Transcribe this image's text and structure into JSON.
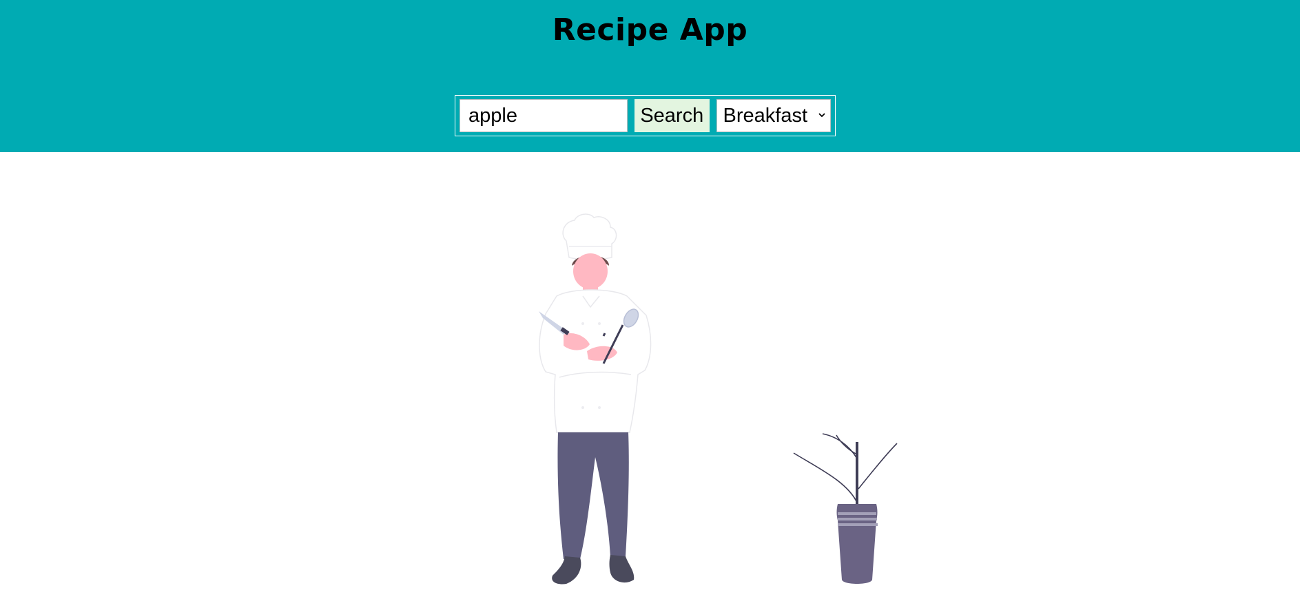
{
  "app": {
    "title": "Recipe App"
  },
  "search": {
    "value": "apple",
    "button_label": "Search"
  },
  "meal_type": {
    "selected": "Breakfast"
  },
  "colors": {
    "header_bg": "#00abb3",
    "button_bg": "#e3f5e0",
    "pants": "#5f5d7e",
    "skin": "#ffb8c2",
    "pot": "#6a6384"
  },
  "illustration": {
    "icons": [
      "chef-icon",
      "knife-icon",
      "spoon-icon",
      "potted-plant-icon"
    ]
  }
}
